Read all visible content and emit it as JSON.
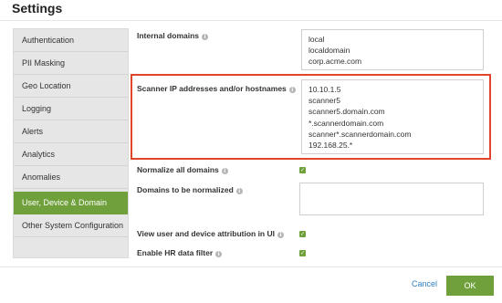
{
  "window": {
    "title": "Settings"
  },
  "sidebar": {
    "items": [
      {
        "label": "Authentication"
      },
      {
        "label": "PII Masking"
      },
      {
        "label": "Geo Location"
      },
      {
        "label": "Logging"
      },
      {
        "label": "Alerts"
      },
      {
        "label": "Analytics"
      },
      {
        "label": "Anomalies"
      },
      {
        "label": "User, Device & Domain",
        "active": true
      },
      {
        "label": "Other System Configuration"
      }
    ]
  },
  "settings": {
    "internal_domains": {
      "label": "Internal domains",
      "lines": [
        "local",
        "localdomain",
        "corp.acme.com"
      ]
    },
    "scanner_hosts": {
      "label": "Scanner IP addresses and/or hostnames",
      "lines": [
        "10.10.1.5",
        "scanner5",
        "scanner5.domain.com",
        "*.scannerdomain.com",
        "scanner*.scannerdomain.com",
        "192.168.25.*"
      ]
    },
    "normalize_all_domains": {
      "label": "Normalize all domains",
      "checked": true
    },
    "domains_to_normalize": {
      "label": "Domains to be normalized",
      "value": ""
    },
    "view_attribution": {
      "label": "View user and device attribution in UI",
      "checked": true
    },
    "hr_filter": {
      "label": "Enable HR data filter",
      "checked": true
    }
  },
  "footer": {
    "cancel_label": "Cancel",
    "ok_label": "OK"
  },
  "colors": {
    "accent_green": "#70a03c",
    "highlight_red": "#e2452d",
    "link_blue": "#2f7fc1"
  },
  "icons": {
    "info": "info-icon",
    "check": "checkmark-icon"
  }
}
